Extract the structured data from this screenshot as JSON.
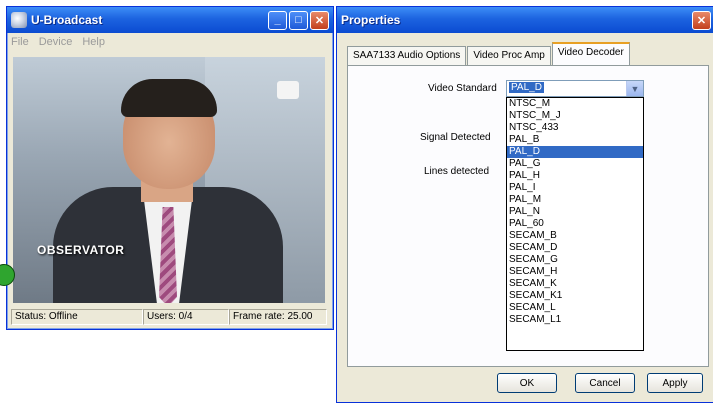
{
  "left_window": {
    "title": "U-Broadcast",
    "menu": [
      "File",
      "Device",
      "Help"
    ],
    "video_overlay_text": "OBSERVATOR",
    "status": {
      "status_text": "Status: Offline",
      "users_text": "Users: 0/4",
      "frame_rate_text": "Frame rate: 25.00"
    }
  },
  "right_window": {
    "title": "Properties",
    "tabs": [
      "SAA7133 Audio Options",
      "Video Proc Amp",
      "Video Decoder"
    ],
    "active_tab": "Video Decoder",
    "labels": {
      "video_standard": "Video Standard",
      "signal_detected": "Signal Detected",
      "lines_detected": "Lines detected"
    },
    "video_standard_value": "PAL_D",
    "dropdown_options": [
      "NTSC_M",
      "NTSC_M_J",
      "NTSC_433",
      "PAL_B",
      "PAL_D",
      "PAL_G",
      "PAL_H",
      "PAL_I",
      "PAL_M",
      "PAL_N",
      "PAL_60",
      "SECAM_B",
      "SECAM_D",
      "SECAM_G",
      "SECAM_H",
      "SECAM_K",
      "SECAM_K1",
      "SECAM_L",
      "SECAM_L1"
    ],
    "selected_option": "PAL_D",
    "buttons": {
      "ok": "OK",
      "cancel": "Cancel",
      "apply": "Apply"
    }
  },
  "colors": {
    "titlebar": "#0b4bd1",
    "selection": "#316ac5",
    "status_indicator": "#2fa52f"
  }
}
